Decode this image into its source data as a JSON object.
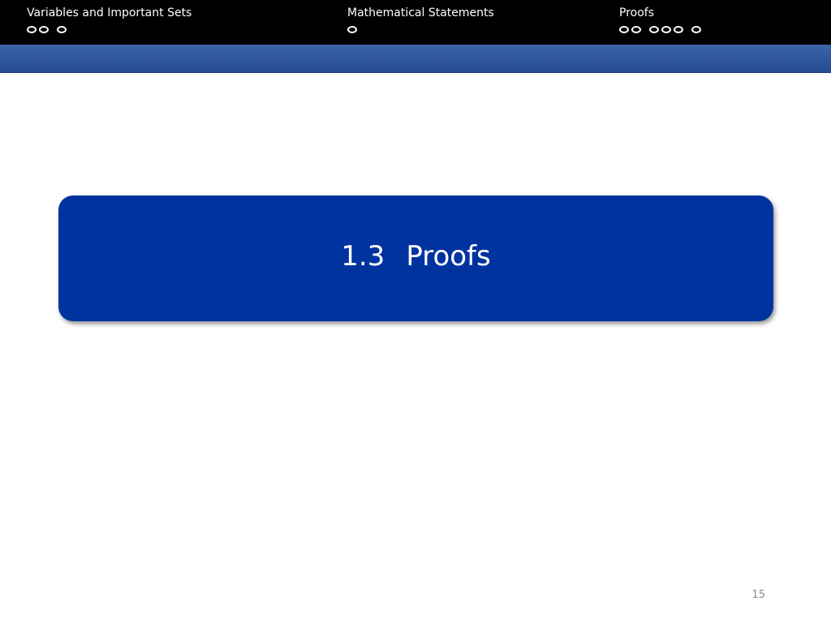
{
  "header": {
    "sections": [
      {
        "title": "Variables and Important Sets",
        "dot_groups": [
          2,
          1
        ]
      },
      {
        "title": "Mathematical Statements",
        "dot_groups": [
          1
        ]
      },
      {
        "title": "Proofs",
        "dot_groups": [
          2,
          3,
          1
        ]
      }
    ]
  },
  "section_block": {
    "number": "1.3",
    "title": "Proofs"
  },
  "footer": {
    "page_number": "15"
  },
  "colors": {
    "headline_background": "#000000",
    "subbar_blue": "#2f559b",
    "block_blue": "#0033a0",
    "text_on_dark": "#ffffff",
    "page_number_gray": "#8a8a8a"
  }
}
